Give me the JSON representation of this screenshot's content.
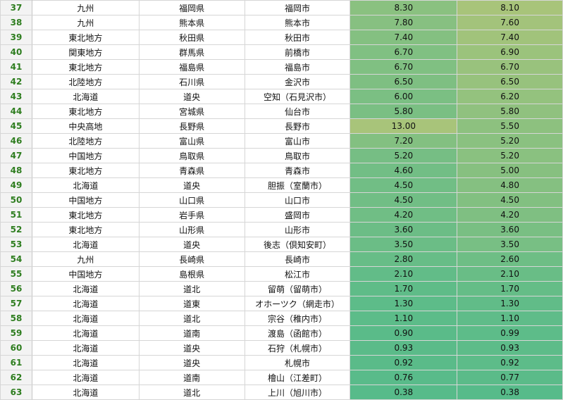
{
  "sheet": {
    "colors": {
      "row_header_text": "#2e7d1f",
      "row_header_bg": "#f3f3f3",
      "gridline": "#d6d6d6",
      "scale_low": "#57bb8a",
      "scale_high": "#a8c47a"
    },
    "rows": [
      {
        "num": "37",
        "region": "九州",
        "pref": "福岡県",
        "city": "福岡市",
        "v1": "8.30",
        "v2": "8.10"
      },
      {
        "num": "38",
        "region": "九州",
        "pref": "熊本県",
        "city": "熊本市",
        "v1": "7.80",
        "v2": "7.60"
      },
      {
        "num": "39",
        "region": "東北地方",
        "pref": "秋田県",
        "city": "秋田市",
        "v1": "7.40",
        "v2": "7.40"
      },
      {
        "num": "40",
        "region": "関東地方",
        "pref": "群馬県",
        "city": "前橋市",
        "v1": "6.70",
        "v2": "6.90"
      },
      {
        "num": "41",
        "region": "東北地方",
        "pref": "福島県",
        "city": "福島市",
        "v1": "6.70",
        "v2": "6.70"
      },
      {
        "num": "42",
        "region": "北陸地方",
        "pref": "石川県",
        "city": "金沢市",
        "v1": "6.50",
        "v2": "6.50"
      },
      {
        "num": "43",
        "region": "北海道",
        "pref": "道央",
        "city": "空知（石見沢市）",
        "v1": "6.00",
        "v2": "6.20"
      },
      {
        "num": "44",
        "region": "東北地方",
        "pref": "宮城県",
        "city": "仙台市",
        "v1": "5.80",
        "v2": "5.80"
      },
      {
        "num": "45",
        "region": "中央高地",
        "pref": "長野県",
        "city": "長野市",
        "v1": "13.00",
        "v2": "5.50"
      },
      {
        "num": "46",
        "region": "北陸地方",
        "pref": "富山県",
        "city": "富山市",
        "v1": "7.20",
        "v2": "5.20"
      },
      {
        "num": "47",
        "region": "中国地方",
        "pref": "鳥取県",
        "city": "鳥取市",
        "v1": "5.20",
        "v2": "5.20"
      },
      {
        "num": "48",
        "region": "東北地方",
        "pref": "青森県",
        "city": "青森市",
        "v1": "4.60",
        "v2": "5.00"
      },
      {
        "num": "49",
        "region": "北海道",
        "pref": "道央",
        "city": "胆振（室蘭市）",
        "v1": "4.50",
        "v2": "4.80"
      },
      {
        "num": "50",
        "region": "中国地方",
        "pref": "山口県",
        "city": "山口市",
        "v1": "4.50",
        "v2": "4.50"
      },
      {
        "num": "51",
        "region": "東北地方",
        "pref": "岩手県",
        "city": "盛岡市",
        "v1": "4.20",
        "v2": "4.20"
      },
      {
        "num": "52",
        "region": "東北地方",
        "pref": "山形県",
        "city": "山形市",
        "v1": "3.60",
        "v2": "3.60"
      },
      {
        "num": "53",
        "region": "北海道",
        "pref": "道央",
        "city": "後志（倶知安町）",
        "v1": "3.50",
        "v2": "3.50"
      },
      {
        "num": "54",
        "region": "九州",
        "pref": "長崎県",
        "city": "長崎市",
        "v1": "2.80",
        "v2": "2.60"
      },
      {
        "num": "55",
        "region": "中国地方",
        "pref": "島根県",
        "city": "松江市",
        "v1": "2.10",
        "v2": "2.10"
      },
      {
        "num": "56",
        "region": "北海道",
        "pref": "道北",
        "city": "留萌（留萌市）",
        "v1": "1.70",
        "v2": "1.70"
      },
      {
        "num": "57",
        "region": "北海道",
        "pref": "道東",
        "city": "オホーツク（網走市）",
        "v1": "1.30",
        "v2": "1.30"
      },
      {
        "num": "58",
        "region": "北海道",
        "pref": "道北",
        "city": "宗谷（稚内市）",
        "v1": "1.10",
        "v2": "1.10"
      },
      {
        "num": "59",
        "region": "北海道",
        "pref": "道南",
        "city": "渡島（函館市）",
        "v1": "0.90",
        "v2": "0.99"
      },
      {
        "num": "60",
        "region": "北海道",
        "pref": "道央",
        "city": "石狩（札幌市）",
        "v1": "0.93",
        "v2": "0.93"
      },
      {
        "num": "61",
        "region": "北海道",
        "pref": "道央",
        "city": "札幌市",
        "v1": "0.92",
        "v2": "0.92"
      },
      {
        "num": "62",
        "region": "北海道",
        "pref": "道南",
        "city": "檜山（江差町）",
        "v1": "0.76",
        "v2": "0.77"
      },
      {
        "num": "63",
        "region": "北海道",
        "pref": "道北",
        "city": "上川（旭川市）",
        "v1": "0.38",
        "v2": "0.38"
      }
    ]
  }
}
